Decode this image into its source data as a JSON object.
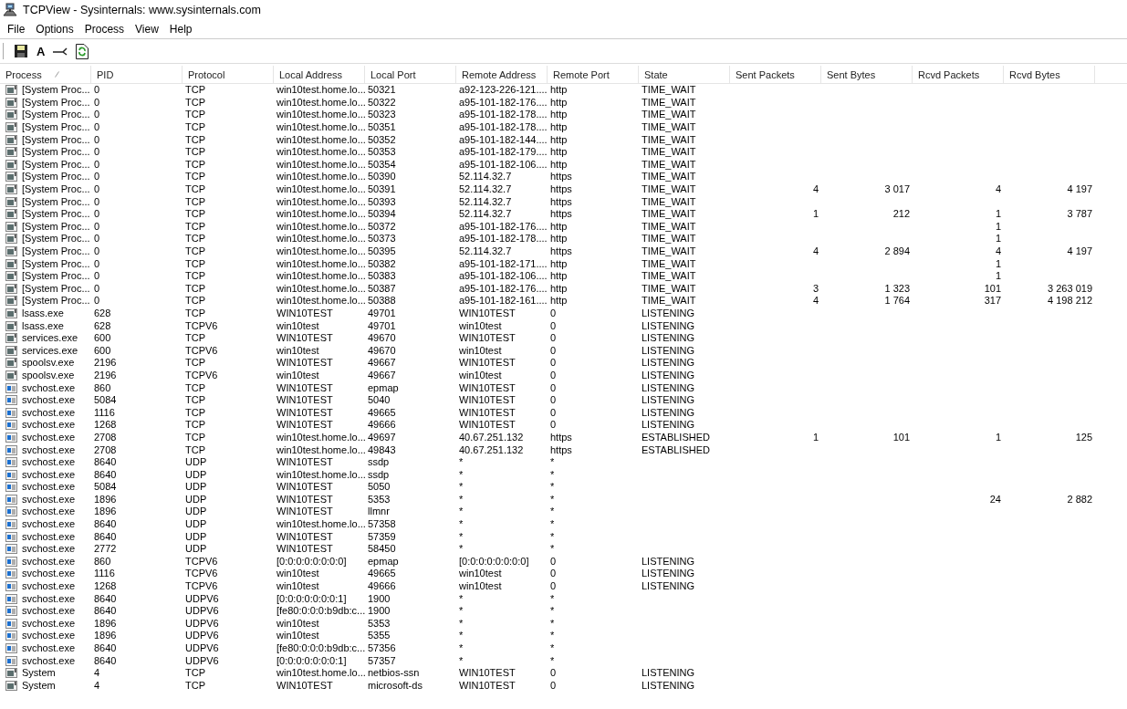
{
  "window": {
    "title": "TCPView - Sysinternals: www.sysinternals.com"
  },
  "menu": [
    "File",
    "Options",
    "Process",
    "View",
    "Help"
  ],
  "toolbar": [
    {
      "kind": "save"
    },
    {
      "kind": "font",
      "label": "A"
    },
    {
      "kind": "connect"
    },
    {
      "kind": "refresh"
    }
  ],
  "table": {
    "columns": [
      {
        "label": "Process",
        "sorted": true,
        "kind": "text"
      },
      {
        "label": "PID",
        "sorted": false,
        "kind": "text"
      },
      {
        "label": "Protocol",
        "sorted": false,
        "kind": "text"
      },
      {
        "label": "Local Address",
        "sorted": false,
        "kind": "text"
      },
      {
        "label": "Local Port",
        "sorted": false,
        "kind": "text"
      },
      {
        "label": "Remote Address",
        "sorted": false,
        "kind": "text"
      },
      {
        "label": "Remote Port",
        "sorted": false,
        "kind": "text"
      },
      {
        "label": "State",
        "sorted": false,
        "kind": "text"
      },
      {
        "label": "Sent Packets",
        "sorted": false,
        "kind": "number"
      },
      {
        "label": "Sent Bytes",
        "sorted": false,
        "kind": "number"
      },
      {
        "label": "Rcvd Packets",
        "sorted": false,
        "kind": "number"
      },
      {
        "label": "Rcvd Bytes",
        "sorted": false,
        "kind": "number"
      }
    ],
    "rows": [
      {
        "kind": "app",
        "cells": [
          "[System Proc...",
          "0",
          "TCP",
          "win10test.home.lo...",
          "50321",
          "a92-123-226-121....",
          "http",
          "TIME_WAIT",
          null,
          null,
          null,
          null
        ]
      },
      {
        "kind": "app",
        "cells": [
          "[System Proc...",
          "0",
          "TCP",
          "win10test.home.lo...",
          "50322",
          "a95-101-182-176....",
          "http",
          "TIME_WAIT",
          null,
          null,
          null,
          null
        ]
      },
      {
        "kind": "app",
        "cells": [
          "[System Proc...",
          "0",
          "TCP",
          "win10test.home.lo...",
          "50323",
          "a95-101-182-178....",
          "http",
          "TIME_WAIT",
          null,
          null,
          null,
          null
        ]
      },
      {
        "kind": "app",
        "cells": [
          "[System Proc...",
          "0",
          "TCP",
          "win10test.home.lo...",
          "50351",
          "a95-101-182-178....",
          "http",
          "TIME_WAIT",
          null,
          null,
          null,
          null
        ]
      },
      {
        "kind": "app",
        "cells": [
          "[System Proc...",
          "0",
          "TCP",
          "win10test.home.lo...",
          "50352",
          "a95-101-182-144....",
          "http",
          "TIME_WAIT",
          null,
          null,
          null,
          null
        ]
      },
      {
        "kind": "app",
        "cells": [
          "[System Proc...",
          "0",
          "TCP",
          "win10test.home.lo...",
          "50353",
          "a95-101-182-179....",
          "http",
          "TIME_WAIT",
          null,
          null,
          null,
          null
        ]
      },
      {
        "kind": "app",
        "cells": [
          "[System Proc...",
          "0",
          "TCP",
          "win10test.home.lo...",
          "50354",
          "a95-101-182-106....",
          "http",
          "TIME_WAIT",
          null,
          null,
          null,
          null
        ]
      },
      {
        "kind": "app",
        "cells": [
          "[System Proc...",
          "0",
          "TCP",
          "win10test.home.lo...",
          "50390",
          "52.114.32.7",
          "https",
          "TIME_WAIT",
          null,
          null,
          null,
          null
        ]
      },
      {
        "kind": "app",
        "cells": [
          "[System Proc...",
          "0",
          "TCP",
          "win10test.home.lo...",
          "50391",
          "52.114.32.7",
          "https",
          "TIME_WAIT",
          "4",
          "3 017",
          "4",
          "4 197"
        ]
      },
      {
        "kind": "app",
        "cells": [
          "[System Proc...",
          "0",
          "TCP",
          "win10test.home.lo...",
          "50393",
          "52.114.32.7",
          "https",
          "TIME_WAIT",
          null,
          null,
          null,
          null
        ]
      },
      {
        "kind": "app",
        "cells": [
          "[System Proc...",
          "0",
          "TCP",
          "win10test.home.lo...",
          "50394",
          "52.114.32.7",
          "https",
          "TIME_WAIT",
          "1",
          "212",
          "1",
          "3 787"
        ]
      },
      {
        "kind": "app",
        "cells": [
          "[System Proc...",
          "0",
          "TCP",
          "win10test.home.lo...",
          "50372",
          "a95-101-182-176....",
          "http",
          "TIME_WAIT",
          null,
          null,
          "1",
          null
        ]
      },
      {
        "kind": "app",
        "cells": [
          "[System Proc...",
          "0",
          "TCP",
          "win10test.home.lo...",
          "50373",
          "a95-101-182-178....",
          "http",
          "TIME_WAIT",
          null,
          null,
          "1",
          null
        ]
      },
      {
        "kind": "app",
        "cells": [
          "[System Proc...",
          "0",
          "TCP",
          "win10test.home.lo...",
          "50395",
          "52.114.32.7",
          "https",
          "TIME_WAIT",
          "4",
          "2 894",
          "4",
          "4 197"
        ]
      },
      {
        "kind": "app",
        "cells": [
          "[System Proc...",
          "0",
          "TCP",
          "win10test.home.lo...",
          "50382",
          "a95-101-182-171....",
          "http",
          "TIME_WAIT",
          null,
          null,
          "1",
          null
        ]
      },
      {
        "kind": "app",
        "cells": [
          "[System Proc...",
          "0",
          "TCP",
          "win10test.home.lo...",
          "50383",
          "a95-101-182-106....",
          "http",
          "TIME_WAIT",
          null,
          null,
          "1",
          null
        ]
      },
      {
        "kind": "app",
        "cells": [
          "[System Proc...",
          "0",
          "TCP",
          "win10test.home.lo...",
          "50387",
          "a95-101-182-176....",
          "http",
          "TIME_WAIT",
          "3",
          "1 323",
          "101",
          "3 263 019"
        ]
      },
      {
        "kind": "app",
        "cells": [
          "[System Proc...",
          "0",
          "TCP",
          "win10test.home.lo...",
          "50388",
          "a95-101-182-161....",
          "http",
          "TIME_WAIT",
          "4",
          "1 764",
          "317",
          "4 198 212"
        ]
      },
      {
        "kind": "app",
        "cells": [
          "lsass.exe",
          "628",
          "TCP",
          "WIN10TEST",
          "49701",
          "WIN10TEST",
          "0",
          "LISTENING",
          null,
          null,
          null,
          null
        ]
      },
      {
        "kind": "app",
        "cells": [
          "lsass.exe",
          "628",
          "TCPV6",
          "win10test",
          "49701",
          "win10test",
          "0",
          "LISTENING",
          null,
          null,
          null,
          null
        ]
      },
      {
        "kind": "app",
        "cells": [
          "services.exe",
          "600",
          "TCP",
          "WIN10TEST",
          "49670",
          "WIN10TEST",
          "0",
          "LISTENING",
          null,
          null,
          null,
          null
        ]
      },
      {
        "kind": "app",
        "cells": [
          "services.exe",
          "600",
          "TCPV6",
          "win10test",
          "49670",
          "win10test",
          "0",
          "LISTENING",
          null,
          null,
          null,
          null
        ]
      },
      {
        "kind": "app",
        "cells": [
          "spoolsv.exe",
          "2196",
          "TCP",
          "WIN10TEST",
          "49667",
          "WIN10TEST",
          "0",
          "LISTENING",
          null,
          null,
          null,
          null
        ]
      },
      {
        "kind": "app",
        "cells": [
          "spoolsv.exe",
          "2196",
          "TCPV6",
          "win10test",
          "49667",
          "win10test",
          "0",
          "LISTENING",
          null,
          null,
          null,
          null
        ]
      },
      {
        "kind": "service",
        "cells": [
          "svchost.exe",
          "860",
          "TCP",
          "WIN10TEST",
          "epmap",
          "WIN10TEST",
          "0",
          "LISTENING",
          null,
          null,
          null,
          null
        ]
      },
      {
        "kind": "service",
        "cells": [
          "svchost.exe",
          "5084",
          "TCP",
          "WIN10TEST",
          "5040",
          "WIN10TEST",
          "0",
          "LISTENING",
          null,
          null,
          null,
          null
        ]
      },
      {
        "kind": "service",
        "cells": [
          "svchost.exe",
          "1116",
          "TCP",
          "WIN10TEST",
          "49665",
          "WIN10TEST",
          "0",
          "LISTENING",
          null,
          null,
          null,
          null
        ]
      },
      {
        "kind": "service",
        "cells": [
          "svchost.exe",
          "1268",
          "TCP",
          "WIN10TEST",
          "49666",
          "WIN10TEST",
          "0",
          "LISTENING",
          null,
          null,
          null,
          null
        ]
      },
      {
        "kind": "service",
        "cells": [
          "svchost.exe",
          "2708",
          "TCP",
          "win10test.home.lo...",
          "49697",
          "40.67.251.132",
          "https",
          "ESTABLISHED",
          "1",
          "101",
          "1",
          "125"
        ]
      },
      {
        "kind": "service",
        "cells": [
          "svchost.exe",
          "2708",
          "TCP",
          "win10test.home.lo...",
          "49843",
          "40.67.251.132",
          "https",
          "ESTABLISHED",
          null,
          null,
          null,
          null
        ]
      },
      {
        "kind": "service",
        "cells": [
          "svchost.exe",
          "8640",
          "UDP",
          "WIN10TEST",
          "ssdp",
          "*",
          "*",
          null,
          null,
          null,
          null,
          null
        ]
      },
      {
        "kind": "service",
        "cells": [
          "svchost.exe",
          "8640",
          "UDP",
          "win10test.home.lo...",
          "ssdp",
          "*",
          "*",
          null,
          null,
          null,
          null,
          null
        ]
      },
      {
        "kind": "service",
        "cells": [
          "svchost.exe",
          "5084",
          "UDP",
          "WIN10TEST",
          "5050",
          "*",
          "*",
          null,
          null,
          null,
          null,
          null
        ]
      },
      {
        "kind": "service",
        "cells": [
          "svchost.exe",
          "1896",
          "UDP",
          "WIN10TEST",
          "5353",
          "*",
          "*",
          null,
          null,
          null,
          "24",
          "2 882"
        ]
      },
      {
        "kind": "service",
        "cells": [
          "svchost.exe",
          "1896",
          "UDP",
          "WIN10TEST",
          "llmnr",
          "*",
          "*",
          null,
          null,
          null,
          null,
          null
        ]
      },
      {
        "kind": "service",
        "cells": [
          "svchost.exe",
          "8640",
          "UDP",
          "win10test.home.lo...",
          "57358",
          "*",
          "*",
          null,
          null,
          null,
          null,
          null
        ]
      },
      {
        "kind": "service",
        "cells": [
          "svchost.exe",
          "8640",
          "UDP",
          "WIN10TEST",
          "57359",
          "*",
          "*",
          null,
          null,
          null,
          null,
          null
        ]
      },
      {
        "kind": "service",
        "cells": [
          "svchost.exe",
          "2772",
          "UDP",
          "WIN10TEST",
          "58450",
          "*",
          "*",
          null,
          null,
          null,
          null,
          null
        ]
      },
      {
        "kind": "service",
        "cells": [
          "svchost.exe",
          "860",
          "TCPV6",
          "[0:0:0:0:0:0:0:0]",
          "epmap",
          "[0:0:0:0:0:0:0:0]",
          "0",
          "LISTENING",
          null,
          null,
          null,
          null
        ]
      },
      {
        "kind": "service",
        "cells": [
          "svchost.exe",
          "1116",
          "TCPV6",
          "win10test",
          "49665",
          "win10test",
          "0",
          "LISTENING",
          null,
          null,
          null,
          null
        ]
      },
      {
        "kind": "service",
        "cells": [
          "svchost.exe",
          "1268",
          "TCPV6",
          "win10test",
          "49666",
          "win10test",
          "0",
          "LISTENING",
          null,
          null,
          null,
          null
        ]
      },
      {
        "kind": "service",
        "cells": [
          "svchost.exe",
          "8640",
          "UDPV6",
          "[0:0:0:0:0:0:0:1]",
          "1900",
          "*",
          "*",
          null,
          null,
          null,
          null,
          null
        ]
      },
      {
        "kind": "service",
        "cells": [
          "svchost.exe",
          "8640",
          "UDPV6",
          "[fe80:0:0:0:b9db:c...",
          "1900",
          "*",
          "*",
          null,
          null,
          null,
          null,
          null
        ]
      },
      {
        "kind": "service",
        "cells": [
          "svchost.exe",
          "1896",
          "UDPV6",
          "win10test",
          "5353",
          "*",
          "*",
          null,
          null,
          null,
          null,
          null
        ]
      },
      {
        "kind": "service",
        "cells": [
          "svchost.exe",
          "1896",
          "UDPV6",
          "win10test",
          "5355",
          "*",
          "*",
          null,
          null,
          null,
          null,
          null
        ]
      },
      {
        "kind": "service",
        "cells": [
          "svchost.exe",
          "8640",
          "UDPV6",
          "[fe80:0:0:0:b9db:c...",
          "57356",
          "*",
          "*",
          null,
          null,
          null,
          null,
          null
        ]
      },
      {
        "kind": "service",
        "cells": [
          "svchost.exe",
          "8640",
          "UDPV6",
          "[0:0:0:0:0:0:0:1]",
          "57357",
          "*",
          "*",
          null,
          null,
          null,
          null,
          null
        ]
      },
      {
        "kind": "app",
        "cells": [
          "System",
          "4",
          "TCP",
          "win10test.home.lo...",
          "netbios-ssn",
          "WIN10TEST",
          "0",
          "LISTENING",
          null,
          null,
          null,
          null
        ]
      },
      {
        "kind": "app",
        "cells": [
          "System",
          "4",
          "TCP",
          "WIN10TEST",
          "microsoft-ds",
          "WIN10TEST",
          "0",
          "LISTENING",
          null,
          null,
          null,
          null
        ]
      }
    ]
  }
}
